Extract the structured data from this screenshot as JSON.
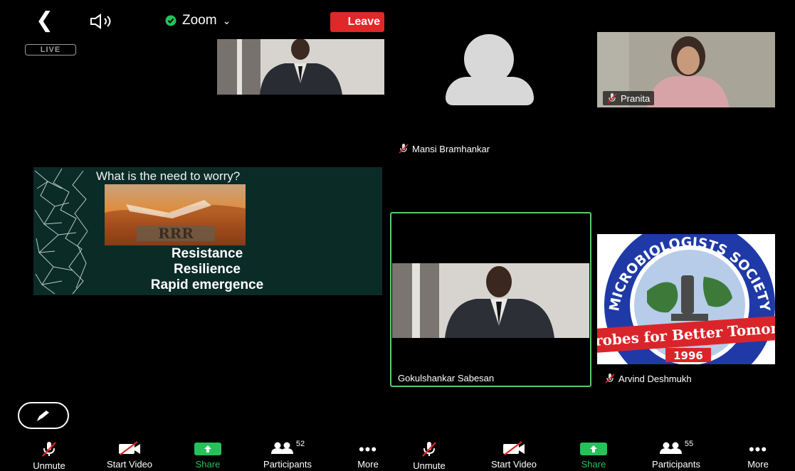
{
  "top_bar": {
    "back_icon": "chevron-left-icon",
    "speaker_icon": "speaker-icon",
    "meeting_name": "Zoom",
    "leave_label": "Leave",
    "live_badge": "LIVE"
  },
  "slide": {
    "title": "What is the need to worry?",
    "lines": [
      "Resistance",
      "Resilience",
      "Rapid emergence"
    ]
  },
  "participants": {
    "mansi": "Mansi Bramhankar",
    "pranita": "Pranita",
    "gokul": "Gokulshankar Sabesan",
    "arvind": "Arvind Deshmukh"
  },
  "logo": {
    "top_text": "MICROBIOLOGISTS SOCIETY",
    "bottom_text": "Microbes for Better Tomorrow",
    "year": "1996"
  },
  "toolbar_left": {
    "unmute": "Unmute",
    "start_video": "Start Video",
    "share": "Share",
    "participants": "Participants",
    "participants_count": "52",
    "more": "More"
  },
  "toolbar_right": {
    "unmute": "Unmute",
    "start_video": "Start Video",
    "share": "Share",
    "participants": "Participants",
    "participants_count": "55",
    "more": "More"
  },
  "colors": {
    "leave_red": "#e02828",
    "active_speaker_green": "#5dc86d",
    "share_green": "#25c25a"
  }
}
